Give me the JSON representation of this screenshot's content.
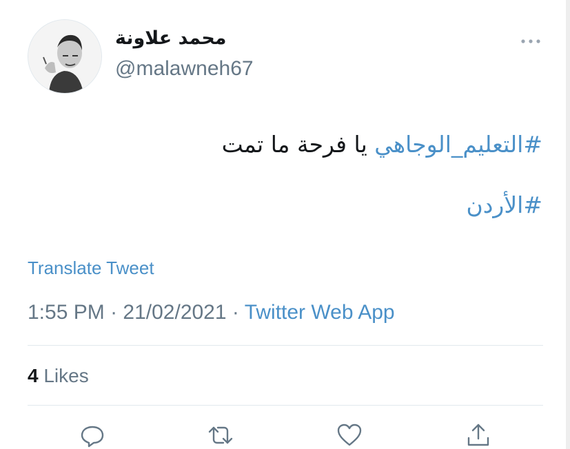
{
  "author": {
    "display_name": "محمد علاونة",
    "handle": "@malawneh67",
    "avatar_icon": "profile-avatar-icon"
  },
  "more_icon": "more-horizontal-icon",
  "tweet": {
    "line1_hashtag": "#التعليم_الوجاهي",
    "line1_text": "يا فرحة ما تمت",
    "line2_hashtag": "#الأردن"
  },
  "translate_label": "Translate Tweet",
  "meta": {
    "time": "1:55 PM",
    "separator1": " · ",
    "date": "21/02/2021",
    "separator2": " · ",
    "source": "Twitter Web App"
  },
  "likes": {
    "count": "4",
    "label": "Likes"
  },
  "actions": {
    "reply_icon": "reply-icon",
    "retweet_icon": "retweet-icon",
    "like_icon": "heart-icon",
    "share_icon": "share-icon"
  },
  "colors": {
    "link": "#4a90c8",
    "secondary_text": "#657786",
    "primary_text": "#14171a",
    "divider": "#e1e8ed"
  }
}
